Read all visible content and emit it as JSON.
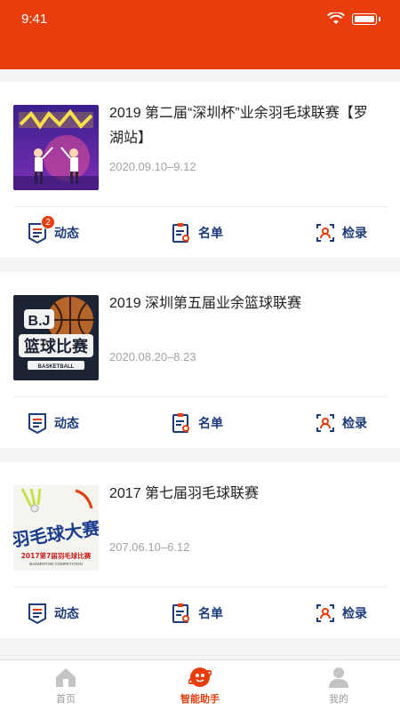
{
  "status_bar": {
    "time": "9:41"
  },
  "colors": {
    "accent": "#e83d0c",
    "action_text": "#1d3a7a",
    "muted_text": "#a3a3a3"
  },
  "events": [
    {
      "title": "2019 第二届“深圳杯”业余羽毛球联赛【罗湖站】",
      "date": "2020.09.10–9.12",
      "thumbnail": "badminton-poster",
      "badge": "2"
    },
    {
      "title": "2019 深圳第五届业余篮球联赛",
      "date": "2020.08.20–8.23",
      "thumbnail": "basketball-poster",
      "thumb_text": "B.J",
      "thumb_sub": "篮球比赛",
      "thumb_small": "BASKETBALL"
    },
    {
      "title": "2017 第七届羽毛球联赛",
      "date": "207.06.10–6.12",
      "thumbnail": "badminton-poster-2017",
      "thumb_text": "羽毛球大赛",
      "thumb_sub": "2017第7届羽毛球比赛",
      "thumb_small": "BADMINTON COMPETITION"
    }
  ],
  "actions": {
    "news": "动态",
    "roster": "名单",
    "checkin": "检录"
  },
  "tabbar": {
    "items": [
      {
        "label": "首页",
        "icon": "home-icon",
        "active": false
      },
      {
        "label": "智能助手",
        "icon": "assistant-icon",
        "active": true
      },
      {
        "label": "我的",
        "icon": "profile-icon",
        "active": false
      }
    ]
  }
}
